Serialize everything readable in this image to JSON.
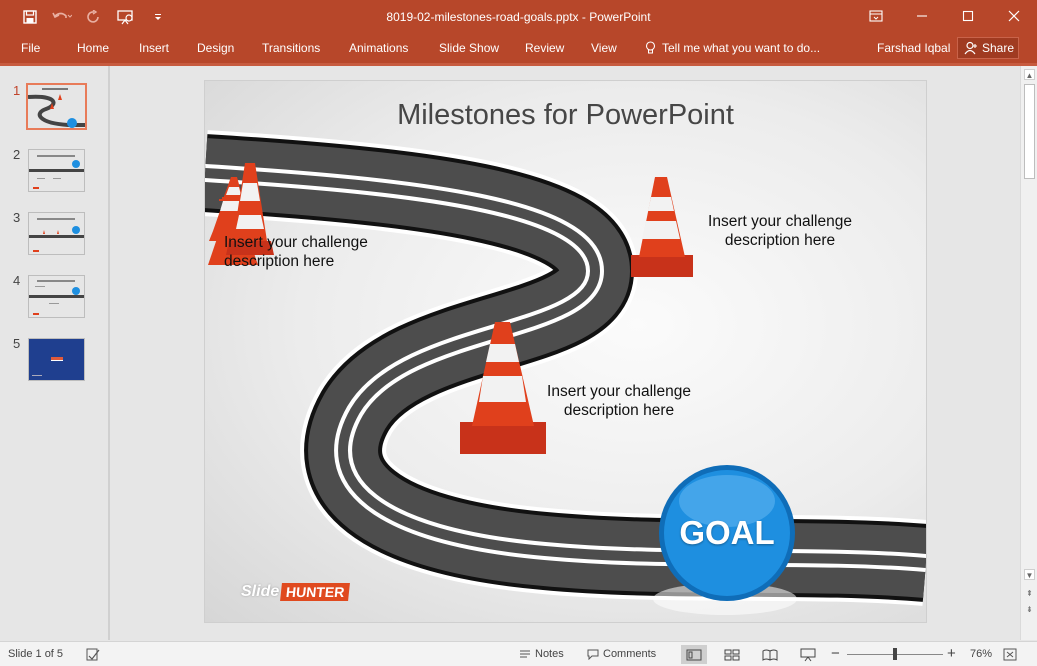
{
  "window": {
    "doc_title": "8019-02-milestones-road-goals.pptx - PowerPoint"
  },
  "qat": {
    "icons": [
      "save-icon",
      "undo-icon",
      "redo-icon",
      "present-from-start-icon",
      "customize-qat-icon"
    ]
  },
  "ribbon": {
    "tabs": [
      "File",
      "Home",
      "Insert",
      "Design",
      "Transitions",
      "Animations",
      "Slide Show",
      "Review",
      "View"
    ],
    "tell_me": "Tell me what you want to do...",
    "user": "Farshad Iqbal",
    "share": "Share"
  },
  "thumbnails": {
    "numbers": [
      "1",
      "2",
      "3",
      "4",
      "5"
    ],
    "active_index": 0
  },
  "slide": {
    "title": "Milestones for PowerPoint",
    "challenge_1": [
      "Insert your challenge",
      "description here"
    ],
    "challenge_2": [
      "Insert your challenge",
      "description here"
    ],
    "challenge_3": [
      "Insert your challenge",
      "description here"
    ],
    "goal": "GOAL",
    "logo_part1": "Slide",
    "logo_part2": "HUNTER"
  },
  "status": {
    "slide_counter": "Slide 1 of 5",
    "notes": "Notes",
    "comments": "Comments",
    "zoom_minus": "−",
    "zoom_plus": "+",
    "zoom_level": "76%",
    "zoom_fraction": 0.5
  },
  "colors": {
    "accent": "#b7472a",
    "road": "#4a4a4a",
    "cone": "#e0401c",
    "goal": "#1e8fe0"
  }
}
